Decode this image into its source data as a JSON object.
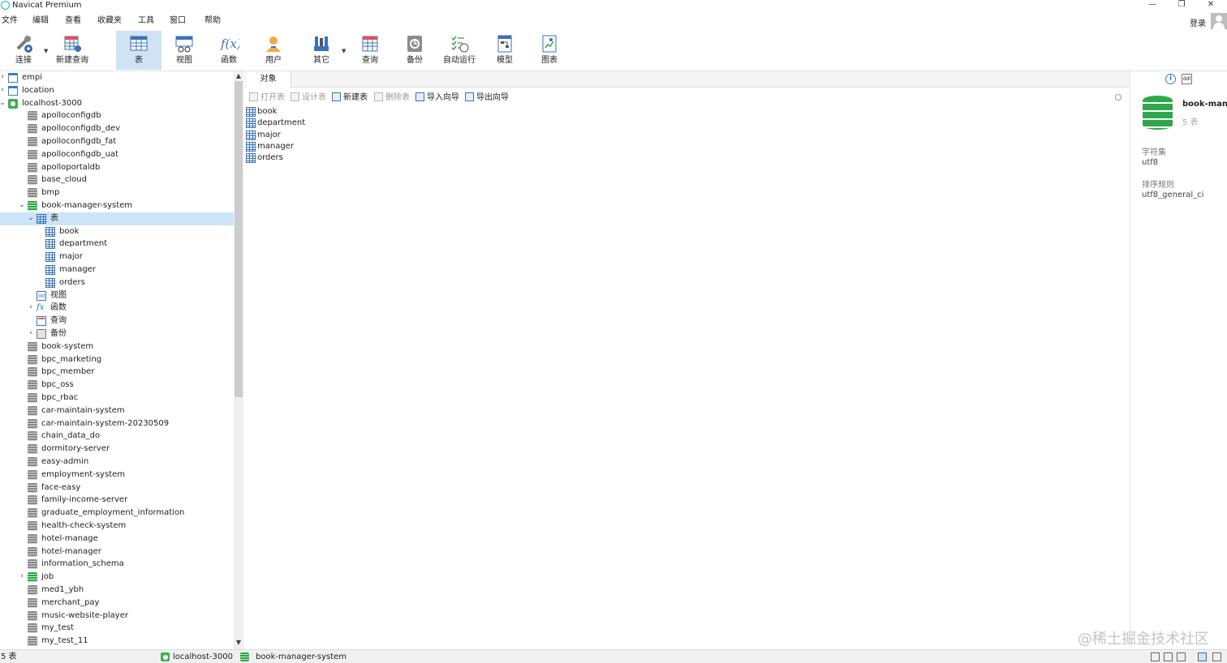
{
  "window": {
    "title": "Navicat Premium",
    "controls": [
      "—",
      "❐",
      "✕"
    ]
  },
  "menu": {
    "items": [
      "文件",
      "编辑",
      "查看",
      "收藏夹",
      "工具",
      "窗口",
      "帮助"
    ],
    "login": "登录"
  },
  "toolbar": {
    "buttons": [
      {
        "label": "连接",
        "icon": "connection-icon",
        "active": false
      },
      {
        "label": "新建查询",
        "icon": "new-query-icon",
        "active": false
      },
      {
        "label": "表",
        "icon": "table-icon",
        "active": true
      },
      {
        "label": "视图",
        "icon": "view-icon",
        "active": false
      },
      {
        "label": "函数",
        "icon": "function-icon",
        "active": false
      },
      {
        "label": "用户",
        "icon": "user-icon",
        "active": false
      },
      {
        "label": "其它",
        "icon": "tools-icon",
        "active": false
      },
      {
        "label": "查询",
        "icon": "query-icon",
        "active": false
      },
      {
        "label": "备份",
        "icon": "backup-icon",
        "active": false
      },
      {
        "label": "自动运行",
        "icon": "automation-icon",
        "active": false
      },
      {
        "label": "模型",
        "icon": "model-icon",
        "active": false
      },
      {
        "label": "图表",
        "icon": "chart-icon",
        "active": false
      }
    ]
  },
  "sidebar": {
    "tree": [
      {
        "label": "empi",
        "level": 0,
        "icon": "folder",
        "chev": "›"
      },
      {
        "label": "location",
        "level": 0,
        "icon": "folder",
        "chev": "›"
      },
      {
        "label": "localhost-3000",
        "level": 0,
        "icon": "connection",
        "chev": "⌄"
      },
      {
        "label": "apolloconfigdb",
        "level": 1,
        "icon": "database"
      },
      {
        "label": "apolloconfigdb_dev",
        "level": 1,
        "icon": "database"
      },
      {
        "label": "apolloconfigdb_fat",
        "level": 1,
        "icon": "database"
      },
      {
        "label": "apolloconfigdb_uat",
        "level": 1,
        "icon": "database"
      },
      {
        "label": "apolloportaldb",
        "level": 1,
        "icon": "database"
      },
      {
        "label": "base_cloud",
        "level": 1,
        "icon": "database"
      },
      {
        "label": "bmp",
        "level": 1,
        "icon": "database"
      },
      {
        "label": "book-manager-system",
        "level": 1,
        "icon": "database-open",
        "chev": "⌄"
      },
      {
        "label": "表",
        "level": 2,
        "icon": "table",
        "chev": "⌄",
        "selected": true
      },
      {
        "label": "book",
        "level": 3,
        "icon": "table"
      },
      {
        "label": "department",
        "level": 3,
        "icon": "table"
      },
      {
        "label": "major",
        "level": 3,
        "icon": "table"
      },
      {
        "label": "manager",
        "level": 3,
        "icon": "table"
      },
      {
        "label": "orders",
        "level": 3,
        "icon": "table"
      },
      {
        "label": "视图",
        "level": 2,
        "icon": "view"
      },
      {
        "label": "函数",
        "level": 2,
        "icon": "function",
        "chev": "›"
      },
      {
        "label": "查询",
        "level": 2,
        "icon": "query"
      },
      {
        "label": "备份",
        "level": 2,
        "icon": "backup",
        "chev": "›"
      },
      {
        "label": "book-system",
        "level": 1,
        "icon": "database"
      },
      {
        "label": "bpc_marketing",
        "level": 1,
        "icon": "database"
      },
      {
        "label": "bpc_member",
        "level": 1,
        "icon": "database"
      },
      {
        "label": "bpc_oss",
        "level": 1,
        "icon": "database"
      },
      {
        "label": "bpc_rbac",
        "level": 1,
        "icon": "database"
      },
      {
        "label": "car-maintain-system",
        "level": 1,
        "icon": "database"
      },
      {
        "label": "car-maintain-system-20230509",
        "level": 1,
        "icon": "database"
      },
      {
        "label": "chain_data_do",
        "level": 1,
        "icon": "database"
      },
      {
        "label": "dormitory-server",
        "level": 1,
        "icon": "database"
      },
      {
        "label": "easy-admin",
        "level": 1,
        "icon": "database"
      },
      {
        "label": "employment-system",
        "level": 1,
        "icon": "database"
      },
      {
        "label": "face-easy",
        "level": 1,
        "icon": "database"
      },
      {
        "label": "family-income-server",
        "level": 1,
        "icon": "database"
      },
      {
        "label": "graduate_employment_information",
        "level": 1,
        "icon": "database"
      },
      {
        "label": "health-check-system",
        "level": 1,
        "icon": "database"
      },
      {
        "label": "hotel-manage",
        "level": 1,
        "icon": "database"
      },
      {
        "label": "hotel-manager",
        "level": 1,
        "icon": "database"
      },
      {
        "label": "information_schema",
        "level": 1,
        "icon": "database"
      },
      {
        "label": "job",
        "level": 1,
        "icon": "database-open",
        "chev": "›"
      },
      {
        "label": "med1_ybh",
        "level": 1,
        "icon": "database"
      },
      {
        "label": "merchant_pay",
        "level": 1,
        "icon": "database"
      },
      {
        "label": "music-website-player",
        "level": 1,
        "icon": "database"
      },
      {
        "label": "my_test",
        "level": 1,
        "icon": "database"
      },
      {
        "label": "my_test_11",
        "level": 1,
        "icon": "database"
      }
    ]
  },
  "main": {
    "tab": "对象",
    "actions": [
      {
        "label": "打开表",
        "enabled": false
      },
      {
        "label": "设计表",
        "enabled": false
      },
      {
        "label": "新建表",
        "enabled": true
      },
      {
        "label": "删除表",
        "enabled": false
      },
      {
        "label": "导入向导",
        "enabled": true
      },
      {
        "label": "导出向导",
        "enabled": true
      }
    ],
    "objects": [
      "book",
      "department",
      "major",
      "manager",
      "orders"
    ]
  },
  "info": {
    "db_name": "book-manager-system",
    "table_count": "5 表",
    "charset_label": "字符集",
    "charset_value": "utf8",
    "collation_label": "排序规则",
    "collation_value": "utf8_general_ci"
  },
  "watermark": "@稀土掘金技术社区",
  "status": {
    "count": "5 表",
    "connection": "localhost-3000",
    "database": "book-manager-system"
  },
  "colors": {
    "accent": "#cfe3f5",
    "selection": "#cce4f7",
    "db_green": "#2ea84a"
  }
}
